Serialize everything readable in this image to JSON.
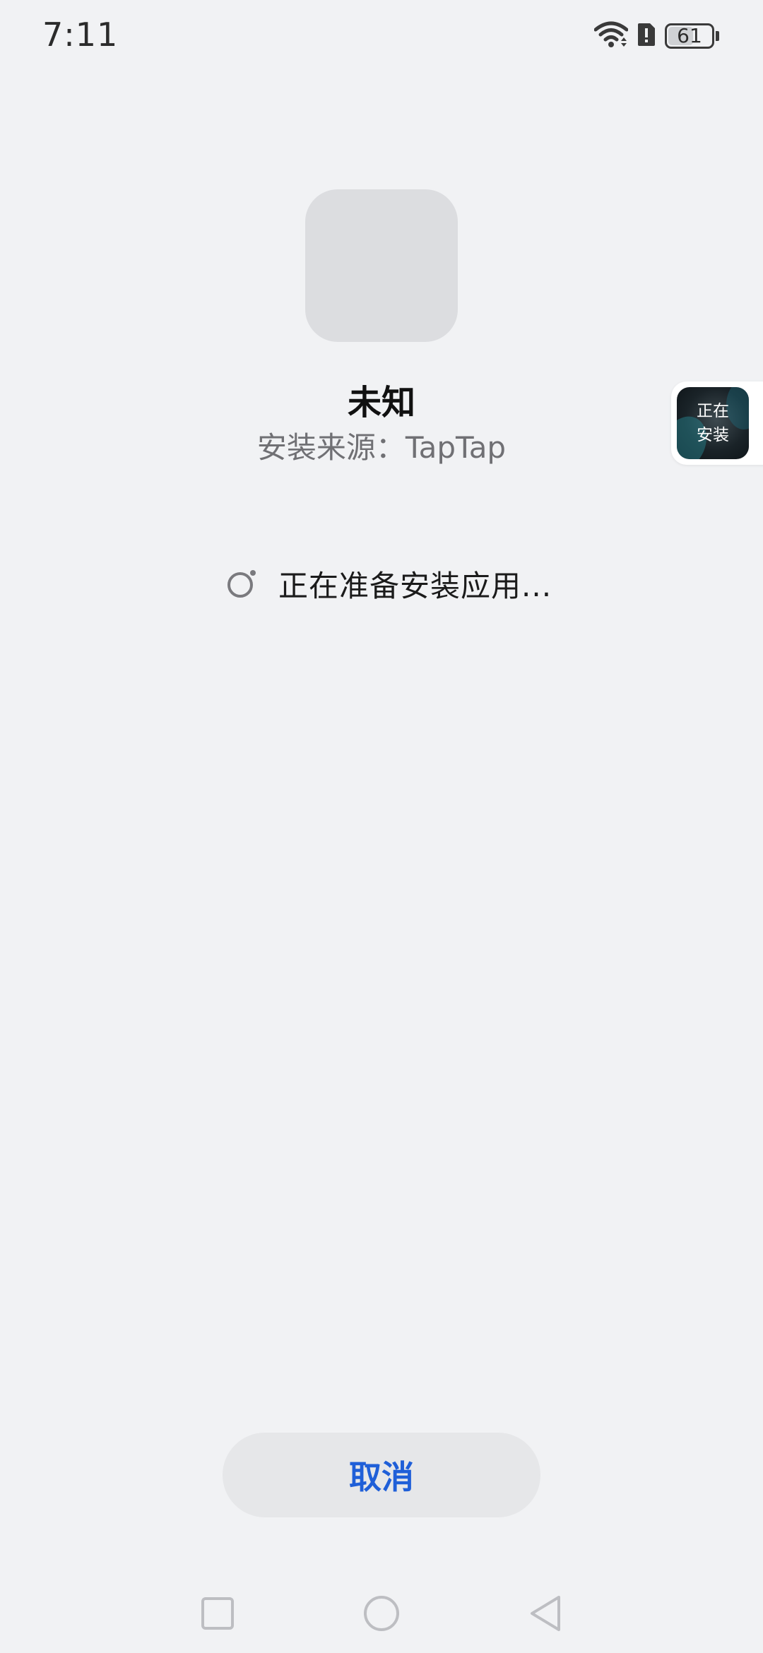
{
  "status_bar": {
    "time": "7:11",
    "battery_level": 61,
    "battery_text": "61",
    "icons": [
      "wifi-icon",
      "sim-alert-icon",
      "battery-icon"
    ]
  },
  "app": {
    "name": "未知",
    "source": "安装来源：TapTap"
  },
  "progress": {
    "text": "正在准备安装应用..."
  },
  "floating_bubble": {
    "line1": "正在",
    "line2": "安装"
  },
  "actions": {
    "cancel_label": "取消"
  },
  "nav": {
    "icons": [
      "recents-icon",
      "home-icon",
      "back-icon"
    ]
  },
  "colors": {
    "background": "#f1f2f4",
    "accent": "#1f5fd8",
    "placeholder": "#dcdde0"
  }
}
